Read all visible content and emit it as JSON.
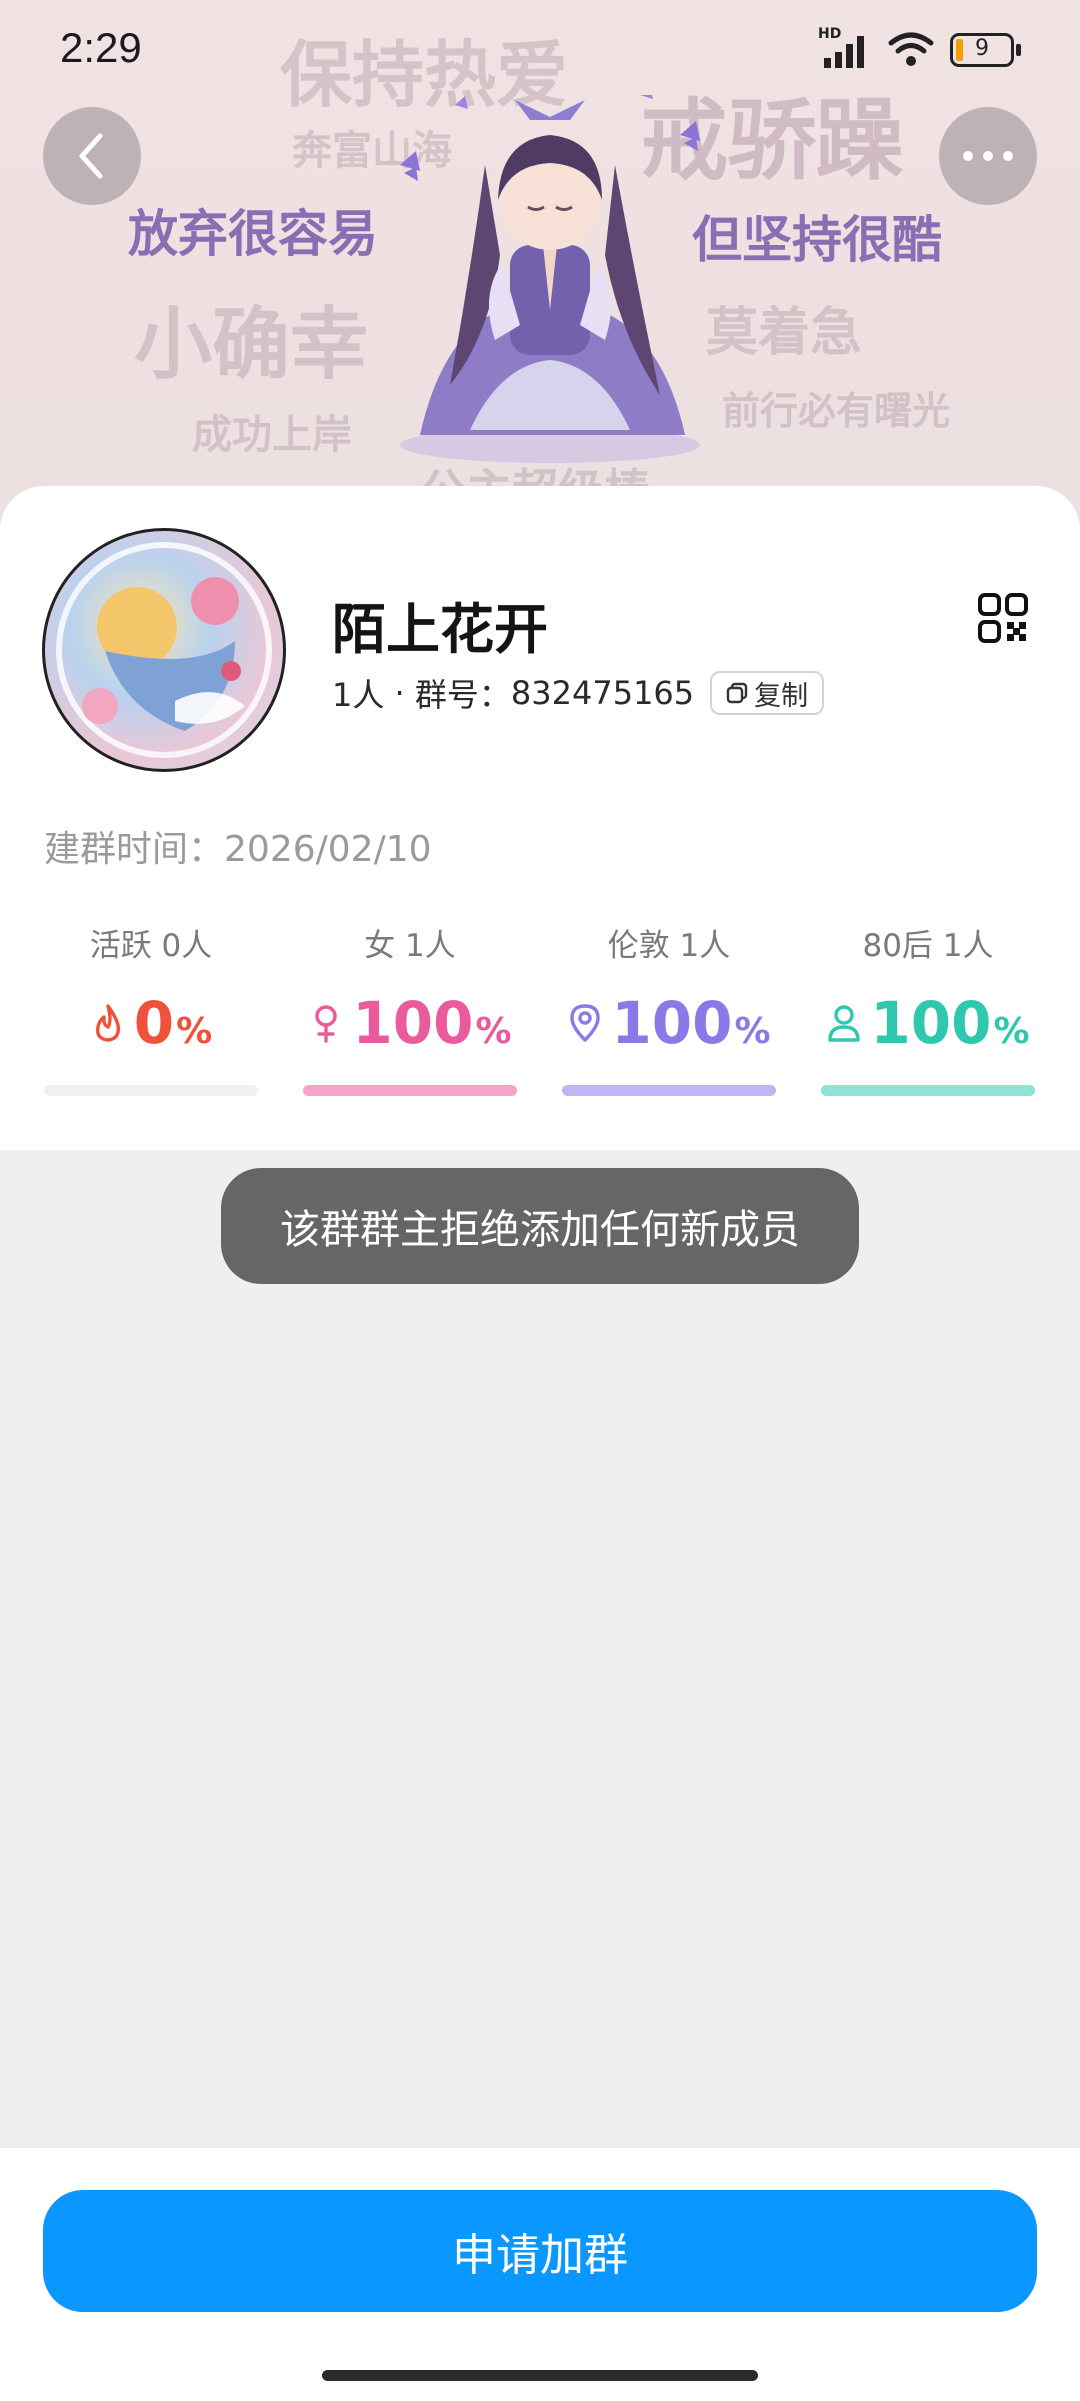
{
  "status_bar": {
    "time": "2:29",
    "network_badge": "HD",
    "battery_level": "9"
  },
  "banner": {
    "texts": [
      "保持热爱",
      "奔富山海",
      "戒骄躁",
      "放弃很容易",
      "但坚持很酷",
      "小确幸",
      "莫着急",
      "成功上岸",
      "前行必有曙光",
      "公主超级棒"
    ]
  },
  "nav": {
    "back_icon": "chevron-left-icon",
    "more_icon": "more-horizontal-icon"
  },
  "group": {
    "name": "陌上花开",
    "member_count": "1人",
    "separator": " · ",
    "id_label": "群号：",
    "id": "832475165",
    "copy_label": "复制",
    "created_label": "建群时间：",
    "created_date": "2026/02/10"
  },
  "stats": [
    {
      "label_key": "活跃",
      "label_count": " 0人",
      "value": "0",
      "unit": "%",
      "icon": "flame-icon",
      "color": "#f0513a",
      "bar_color": "#f0f0f0",
      "fill": 0
    },
    {
      "label_key": "女",
      "label_count": " 1人",
      "value": "100",
      "unit": "%",
      "icon": "female-icon",
      "color": "#ea5b9d",
      "bar_color": "#f7a3c7",
      "fill": 1
    },
    {
      "label_key": "伦敦",
      "label_count": " 1人",
      "value": "100",
      "unit": "%",
      "icon": "location-pin-icon",
      "color": "#8c78e6",
      "bar_color": "#c3b5f3",
      "fill": 1
    },
    {
      "label_key": "80后",
      "label_count": " 1人",
      "value": "100",
      "unit": "%",
      "icon": "person-icon",
      "color": "#2fc7ae",
      "bar_color": "#8fe2d6",
      "fill": 1
    }
  ],
  "toast": "该群群主拒绝添加任何新成员",
  "footer": {
    "apply_button": "申请加群"
  }
}
